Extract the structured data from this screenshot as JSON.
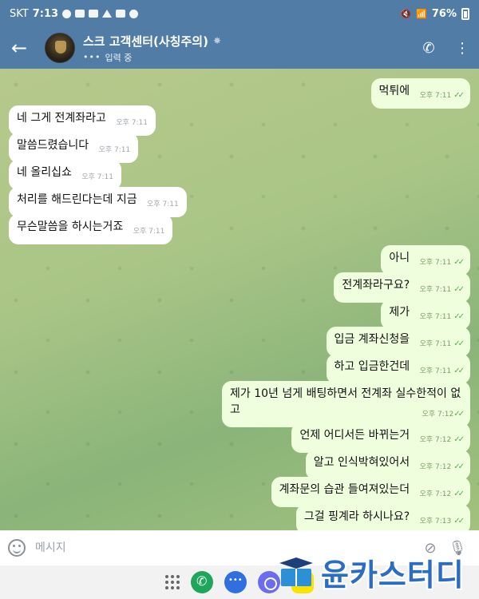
{
  "status_bar": {
    "carrier": "SKT",
    "time": "7:13",
    "battery": "76%"
  },
  "header": {
    "title": "스크 고객센터(사칭주의)",
    "subtitle": "입력 중",
    "colors": {
      "bar": "#517ca5"
    }
  },
  "messages": [
    {
      "dir": "out",
      "text": "먹튀에",
      "time": "오후 7:11"
    },
    {
      "dir": "in",
      "text": "네 그게 전계좌라고",
      "time": "오후 7:11"
    },
    {
      "dir": "in",
      "text": "말씀드렸습니다",
      "time": "오후 7:11"
    },
    {
      "dir": "in",
      "text": "네 올리십쇼",
      "time": "오후 7:11"
    },
    {
      "dir": "in",
      "text": "처리를 해드린다는데 지금",
      "time": "오후 7:11"
    },
    {
      "dir": "in",
      "text": "무슨말씀을 하시는거죠",
      "time": "오후 7:11"
    },
    {
      "dir": "out",
      "text": "아니",
      "time": "오후 7:11"
    },
    {
      "dir": "out",
      "text": "전계좌라구요?",
      "time": "오후 7:11"
    },
    {
      "dir": "out",
      "text": "제가",
      "time": "오후 7:11"
    },
    {
      "dir": "out",
      "text": "입금 계좌신청을",
      "time": "오후 7:11"
    },
    {
      "dir": "out",
      "text": "하고 입금한건데",
      "time": "오후 7:11"
    },
    {
      "dir": "out",
      "text": "제가 10년 넘게 배팅하면서 전계좌 실수한적이 없고",
      "time": "오후 7:12"
    },
    {
      "dir": "out",
      "text": "언제 어디서든 바뀌는거",
      "time": "오후 7:12"
    },
    {
      "dir": "out",
      "text": "알고 인식박혀있어서",
      "time": "오후 7:12"
    },
    {
      "dir": "out",
      "text": "계좌문의 습관 들여져있는더",
      "time": "오후 7:12"
    },
    {
      "dir": "out",
      "text": "그걸 핑계라 하시나요?",
      "time": "오후 7:13"
    }
  ],
  "input": {
    "placeholder": "메시지"
  },
  "watermark": {
    "text": "윤카스터디"
  },
  "icons": {
    "back": "arrow-left-icon",
    "call": "phone-icon",
    "menu": "more-vertical-icon",
    "emoji": "emoji-icon",
    "attach": "paperclip-icon",
    "mic": "microphone-icon"
  }
}
